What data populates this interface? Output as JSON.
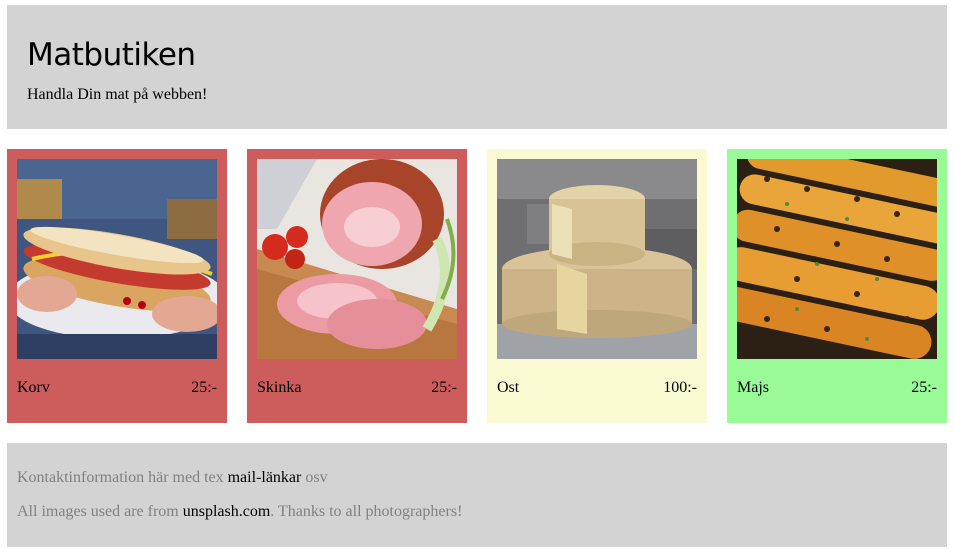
{
  "header": {
    "title": "Matbutiken",
    "tagline": "Handla Din mat på webben!"
  },
  "colors": {
    "header_bg": "#d3d3d3",
    "card_red": "#cd5c5c",
    "card_cream": "#fafad2",
    "card_green": "#98fb98"
  },
  "products": [
    {
      "name": "Korv",
      "price": "25:-",
      "image": "hotdog-photo",
      "color": "#cd5c5c"
    },
    {
      "name": "Skinka",
      "price": "25:-",
      "image": "ham-photo",
      "color": "#cd5c5c"
    },
    {
      "name": "Ost",
      "price": "100:-",
      "image": "cheese-photo",
      "color": "#fafad2"
    },
    {
      "name": "Majs",
      "price": "25:-",
      "image": "corn-photo",
      "color": "#98fb98"
    }
  ],
  "footer": {
    "contact_prefix": "Kontaktinformation här med tex",
    "contact_link": "mail-länkar",
    "contact_suffix": "osv",
    "credits_prefix": "All images used are from",
    "credits_link": "unsplash.com",
    "credits_suffix": ". Thanks to all photographers!"
  }
}
